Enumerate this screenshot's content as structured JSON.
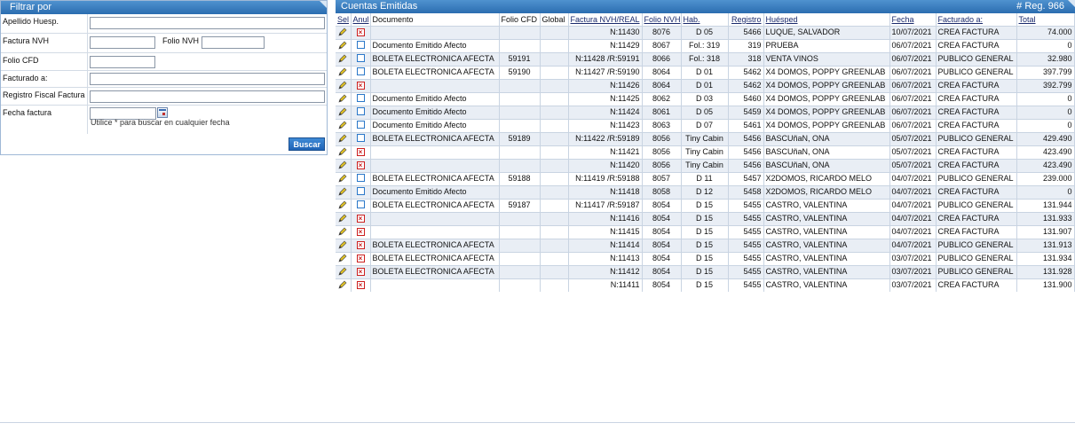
{
  "filter": {
    "title": "Filtrar por",
    "fields": [
      {
        "label": "Apellido Huesp.",
        "value": ""
      },
      {
        "label": "Factura NVH",
        "value": ""
      },
      {
        "label": "Folio CFD",
        "value": ""
      },
      {
        "label": "Facturado a:",
        "value": ""
      },
      {
        "label": "Registro Fiscal Factura",
        "value": ""
      },
      {
        "label": "Fecha factura",
        "value": ""
      }
    ],
    "folio_nvh_label": "Folio NVH",
    "folio_nvh_value": "",
    "hint": "Utilice * para buscar en cualquier fecha",
    "search_label": "Buscar"
  },
  "results": {
    "title": "Cuentas Emitidas",
    "count_label": "# Reg. 966",
    "columns": [
      "Sel",
      "Anul",
      "Documento",
      "Folio CFD",
      "Global",
      "Factura NVH/REAL",
      "Folio NVH",
      "Hab.",
      "Registro",
      "Huésped",
      "Fecha",
      "Facturado a:",
      "Total"
    ],
    "rows": [
      {
        "anul": true,
        "documento": "",
        "folio_cfd": "",
        "global": "",
        "factura": "N:11430",
        "folio_nvh": "8076",
        "hab": "D 05",
        "registro": "5466",
        "huesped": "LUQUE, SALVADOR",
        "fecha": "10/07/2021",
        "facturado": "CREA FACTURA",
        "total": "74.000"
      },
      {
        "anul": false,
        "documento": "Documento Emitido Afecto",
        "folio_cfd": "",
        "global": "",
        "factura": "N:11429",
        "folio_nvh": "8067",
        "hab": "Fol.: 319",
        "registro": "319",
        "huesped": "PRUEBA",
        "fecha": "06/07/2021",
        "facturado": "CREA FACTURA",
        "total": "0"
      },
      {
        "anul": false,
        "documento": "BOLETA ELECTRONICA AFECTA",
        "folio_cfd": "59191",
        "global": "",
        "factura": "N:11428 /R:59191",
        "folio_nvh": "8066",
        "hab": "Fol.: 318",
        "registro": "318",
        "huesped": "VENTA VINOS",
        "fecha": "06/07/2021",
        "facturado": "PUBLICO GENERAL",
        "total": "32.980"
      },
      {
        "anul": false,
        "documento": "BOLETA ELECTRONICA AFECTA",
        "folio_cfd": "59190",
        "global": "",
        "factura": "N:11427 /R:59190",
        "folio_nvh": "8064",
        "hab": "D 01",
        "registro": "5462",
        "huesped": "X4 DOMOS, POPPY GREENLAB",
        "fecha": "06/07/2021",
        "facturado": "PUBLICO GENERAL",
        "total": "397.799"
      },
      {
        "anul": true,
        "documento": "",
        "folio_cfd": "",
        "global": "",
        "factura": "N:11426",
        "folio_nvh": "8064",
        "hab": "D 01",
        "registro": "5462",
        "huesped": "X4 DOMOS, POPPY GREENLAB",
        "fecha": "06/07/2021",
        "facturado": "CREA FACTURA",
        "total": "392.799"
      },
      {
        "anul": false,
        "documento": "Documento Emitido Afecto",
        "folio_cfd": "",
        "global": "",
        "factura": "N:11425",
        "folio_nvh": "8062",
        "hab": "D 03",
        "registro": "5460",
        "huesped": "X4 DOMOS, POPPY GREENLAB",
        "fecha": "06/07/2021",
        "facturado": "CREA FACTURA",
        "total": "0"
      },
      {
        "anul": false,
        "documento": "Documento Emitido Afecto",
        "folio_cfd": "",
        "global": "",
        "factura": "N:11424",
        "folio_nvh": "8061",
        "hab": "D 05",
        "registro": "5459",
        "huesped": "X4 DOMOS, POPPY GREENLAB",
        "fecha": "06/07/2021",
        "facturado": "CREA FACTURA",
        "total": "0"
      },
      {
        "anul": false,
        "documento": "Documento Emitido Afecto",
        "folio_cfd": "",
        "global": "",
        "factura": "N:11423",
        "folio_nvh": "8063",
        "hab": "D 07",
        "registro": "5461",
        "huesped": "X4 DOMOS, POPPY GREENLAB",
        "fecha": "06/07/2021",
        "facturado": "CREA FACTURA",
        "total": "0"
      },
      {
        "anul": false,
        "documento": "BOLETA ELECTRONICA AFECTA",
        "folio_cfd": "59189",
        "global": "",
        "factura": "N:11422 /R:59189",
        "folio_nvh": "8056",
        "hab": "Tiny Cabin",
        "registro": "5456",
        "huesped": "BASCUñaN, ONA",
        "fecha": "05/07/2021",
        "facturado": "PUBLICO GENERAL",
        "total": "429.490"
      },
      {
        "anul": true,
        "documento": "",
        "folio_cfd": "",
        "global": "",
        "factura": "N:11421",
        "folio_nvh": "8056",
        "hab": "Tiny Cabin",
        "registro": "5456",
        "huesped": "BASCUñaN, ONA",
        "fecha": "05/07/2021",
        "facturado": "CREA FACTURA",
        "total": "423.490"
      },
      {
        "anul": true,
        "documento": "",
        "folio_cfd": "",
        "global": "",
        "factura": "N:11420",
        "folio_nvh": "8056",
        "hab": "Tiny Cabin",
        "registro": "5456",
        "huesped": "BASCUñaN, ONA",
        "fecha": "05/07/2021",
        "facturado": "CREA FACTURA",
        "total": "423.490"
      },
      {
        "anul": false,
        "documento": "BOLETA ELECTRONICA AFECTA",
        "folio_cfd": "59188",
        "global": "",
        "factura": "N:11419 /R:59188",
        "folio_nvh": "8057",
        "hab": "D 11",
        "registro": "5457",
        "huesped": "X2DOMOS, RICARDO MELO",
        "fecha": "04/07/2021",
        "facturado": "PUBLICO GENERAL",
        "total": "239.000"
      },
      {
        "anul": false,
        "documento": "Documento Emitido Afecto",
        "folio_cfd": "",
        "global": "",
        "factura": "N:11418",
        "folio_nvh": "8058",
        "hab": "D 12",
        "registro": "5458",
        "huesped": "X2DOMOS, RICARDO MELO",
        "fecha": "04/07/2021",
        "facturado": "CREA FACTURA",
        "total": "0"
      },
      {
        "anul": false,
        "documento": "BOLETA ELECTRONICA AFECTA",
        "folio_cfd": "59187",
        "global": "",
        "factura": "N:11417 /R:59187",
        "folio_nvh": "8054",
        "hab": "D 15",
        "registro": "5455",
        "huesped": "CASTRO, VALENTINA",
        "fecha": "04/07/2021",
        "facturado": "PUBLICO GENERAL",
        "total": "131.944"
      },
      {
        "anul": true,
        "documento": "",
        "folio_cfd": "",
        "global": "",
        "factura": "N:11416",
        "folio_nvh": "8054",
        "hab": "D 15",
        "registro": "5455",
        "huesped": "CASTRO, VALENTINA",
        "fecha": "04/07/2021",
        "facturado": "CREA FACTURA",
        "total": "131.933"
      },
      {
        "anul": true,
        "documento": "",
        "folio_cfd": "",
        "global": "",
        "factura": "N:11415",
        "folio_nvh": "8054",
        "hab": "D 15",
        "registro": "5455",
        "huesped": "CASTRO, VALENTINA",
        "fecha": "04/07/2021",
        "facturado": "CREA FACTURA",
        "total": "131.907"
      },
      {
        "anul": true,
        "documento": "BOLETA ELECTRONICA AFECTA",
        "folio_cfd": "",
        "global": "",
        "factura": "N:11414",
        "folio_nvh": "8054",
        "hab": "D 15",
        "registro": "5455",
        "huesped": "CASTRO, VALENTINA",
        "fecha": "04/07/2021",
        "facturado": "PUBLICO GENERAL",
        "total": "131.913"
      },
      {
        "anul": true,
        "documento": "BOLETA ELECTRONICA AFECTA",
        "folio_cfd": "",
        "global": "",
        "factura": "N:11413",
        "folio_nvh": "8054",
        "hab": "D 15",
        "registro": "5455",
        "huesped": "CASTRO, VALENTINA",
        "fecha": "03/07/2021",
        "facturado": "PUBLICO GENERAL",
        "total": "131.934"
      },
      {
        "anul": true,
        "documento": "BOLETA ELECTRONICA AFECTA",
        "folio_cfd": "",
        "global": "",
        "factura": "N:11412",
        "folio_nvh": "8054",
        "hab": "D 15",
        "registro": "5455",
        "huesped": "CASTRO, VALENTINA",
        "fecha": "03/07/2021",
        "facturado": "PUBLICO GENERAL",
        "total": "131.928"
      },
      {
        "anul": true,
        "documento": "",
        "folio_cfd": "",
        "global": "",
        "factura": "N:11411",
        "folio_nvh": "8054",
        "hab": "D 15",
        "registro": "5455",
        "huesped": "CASTRO, VALENTINA",
        "fecha": "03/07/2021",
        "facturado": "CREA FACTURA",
        "total": "131.900"
      }
    ]
  },
  "colors": {
    "title_bar": "#2b6db0",
    "row_alt": "#e9eef5",
    "anul_red": "#cc1f1f",
    "checkbox_blue": "#2b78c9",
    "pencil": "#e0c020"
  },
  "icons": {
    "edit": "pencil-icon",
    "anulled": "red-x-checkbox-icon",
    "not_anulled": "empty-checkbox-icon",
    "calendar": "calendar-icon"
  }
}
